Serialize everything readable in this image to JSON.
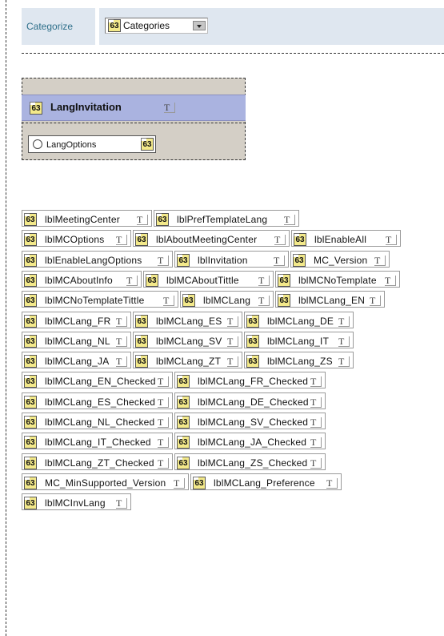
{
  "categorize": {
    "label": "Categorize",
    "combo_value": "Categories",
    "combo_badge": "63"
  },
  "panel": {
    "title": "LangInvitation",
    "title_badge": "63",
    "option_label": "LangOptions",
    "option_badge": "63"
  },
  "labels_badge": "63",
  "labels_type_glyph": "T",
  "label_rows": [
    [
      "lblMeetingCenter",
      "lblPrefTemplateLang"
    ],
    [
      "lblMCOptions",
      "lblAboutMeetingCenter",
      "lblEnableAll"
    ],
    [
      "lblEnableLangOptions",
      "lblInvitation",
      "MC_Version"
    ],
    [
      "lblMCAboutInfo",
      "lblMCAboutTittle",
      "lblMCNoTemplate"
    ],
    [
      "lblMCNoTemplateTittle",
      "lblMCLang",
      "lblMCLang_EN"
    ],
    [
      "lblMCLang_FR",
      "lblMCLang_ES",
      "lblMCLang_DE"
    ],
    [
      "lblMCLang_NL",
      "lblMCLang_SV",
      "lblMCLang_IT"
    ],
    [
      "lblMCLang_JA",
      "lblMCLang_ZT",
      "lblMCLang_ZS"
    ],
    [
      "lblMCLang_EN_Checked",
      "lblMCLang_FR_Checked"
    ],
    [
      "lblMCLang_ES_Checked",
      "lblMCLang_DE_Checked"
    ],
    [
      "lblMCLang_NL_Checked",
      "lblMCLang_SV_Checked"
    ],
    [
      "lblMCLang_IT_Checked",
      "lblMCLang_JA_Checked"
    ],
    [
      "lblMCLang_ZT_Checked",
      "lblMCLang_ZS_Checked"
    ],
    [
      "MC_MinSupported_Version",
      "lblMCLang_Preference"
    ],
    [
      "lblMCInvLang"
    ]
  ],
  "colors": {
    "band": "#dfe7f0",
    "panel": "#d4cfc6",
    "header": "#aab3e0",
    "badge": "#f3e98a"
  }
}
